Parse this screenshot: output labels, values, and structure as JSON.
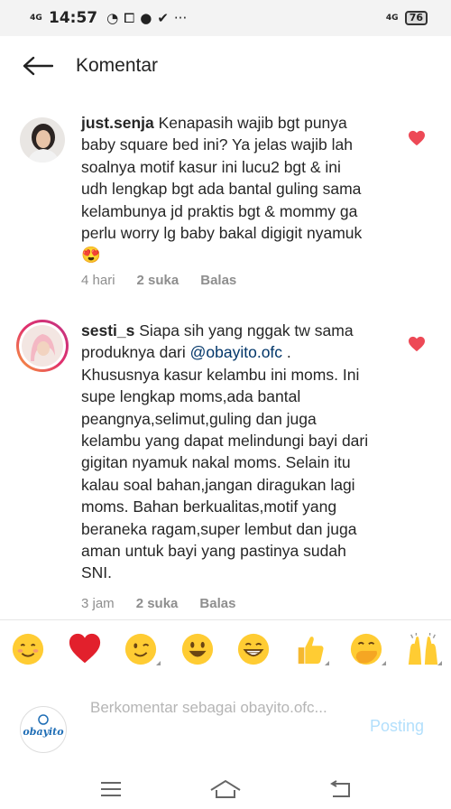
{
  "status_bar": {
    "network_left": "4G",
    "time": "14:57",
    "network_right": "4G",
    "battery": "76"
  },
  "header": {
    "title": "Komentar"
  },
  "comments": [
    {
      "username": "just.senja",
      "text": " Kenapasih wajib bgt punya baby square bed ini? Ya jelas wajib lah soalnya motif kasur ini lucu2 bgt & ini udh lengkap bgt ada bantal guling sama kelambunya jd praktis bgt & mommy ga perlu worry lg baby bakal digigit nyamuk ",
      "emoji": "😍",
      "time": "4 hari",
      "likes": "2 suka",
      "reply": "Balas"
    },
    {
      "username": "sesti_s",
      "text_before": " Siapa sih yang nggak tw sama produknya dari ",
      "mention": "@obayito.ofc",
      "text_after": " . Khususnya kasur kelambu ini moms. Ini supe lengkap moms,ada bantal peangnya,selimut,guling dan juga kelambu yang dapat melindungi bayi dari gigitan nyamuk nakal moms. Selain itu kalau soal bahan,jangan diragukan lagi moms. Bahan berkualitas,motif yang beraneka ragam,super lembut dan juga aman untuk bayi yang pastinya sudah SNI.",
      "time": "3 jam",
      "likes": "2 suka",
      "reply": "Balas"
    }
  ],
  "emoji_bar": [
    "smiling-face",
    "red-heart",
    "winking-face",
    "grinning-face",
    "beaming-face",
    "thumbs-up",
    "hand-over-mouth",
    "raising-hands"
  ],
  "composer": {
    "placeholder": "Berkomentar sebagai obayito.ofc...",
    "brand": "obayito",
    "post_label": "Posting"
  },
  "colors": {
    "heart": "#ed4956",
    "mention": "#003569",
    "post_disabled": "#b2dffc",
    "meta": "#8e8e8e"
  }
}
